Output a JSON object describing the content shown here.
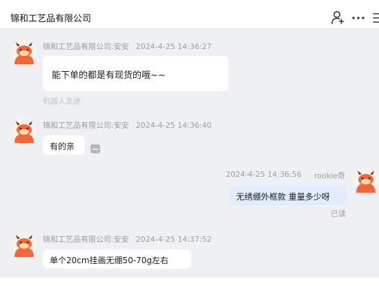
{
  "header": {
    "title": "锦和工艺品有限公司",
    "icons": [
      "add-user-icon",
      "more-icon",
      "list-icon"
    ]
  },
  "messages": [
    {
      "sender": "锦和工艺品有限公司:安安",
      "time": "2024-4-25 14:36:27",
      "text": "能下单的都是有现货的哦~~",
      "note": "机器人发送"
    },
    {
      "sender": "锦和工艺品有限公司:安安",
      "time": "2024-4-25 14:36:40",
      "text": "有的亲"
    },
    {
      "sender": "rookie奇",
      "time": "2024-4-25 14:36:56",
      "text": "无绣绷外框款 重量多少呀",
      "status": "已读"
    },
    {
      "sender": "锦和工艺品有限公司:安安",
      "time": "2024-4-25 14:37:52",
      "text": "单个20cm挂画无绷50-70g左右"
    }
  ],
  "colors": {
    "background": "#eff0f3",
    "bubble_other": "#ffffff",
    "bubble_mine": "#e2ecff",
    "avatar_orange": "#f2663a"
  }
}
